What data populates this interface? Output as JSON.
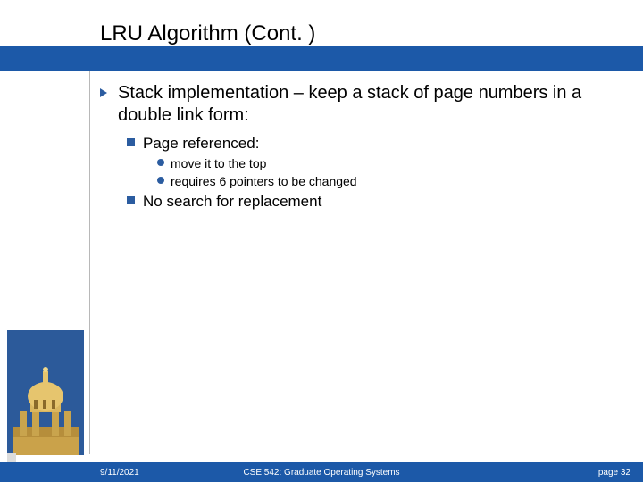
{
  "title": "LRU Algorithm (Cont. )",
  "bullets": {
    "l1": "Stack implementation – keep a stack of page numbers in a double link form:",
    "l2a": "Page referenced:",
    "l3a": "move it to the top",
    "l3b": "requires 6 pointers to be changed",
    "l2b": "No search for replacement"
  },
  "footer": {
    "date": "9/11/2021",
    "course": "CSE 542: Graduate Operating Systems",
    "page": "page 32"
  }
}
